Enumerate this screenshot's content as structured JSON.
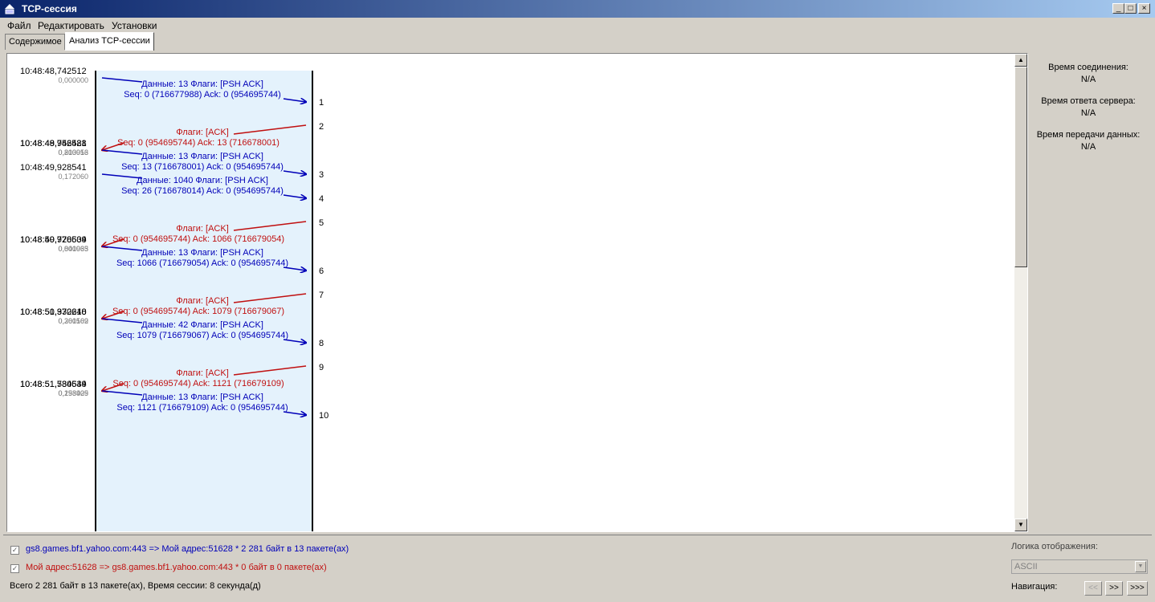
{
  "window": {
    "title": "TCP-сессия"
  },
  "menu": [
    "Файл",
    "Редактировать",
    "Установки"
  ],
  "tabs": [
    {
      "label": "Содержимое",
      "active": false
    },
    {
      "label": "Анализ TCP-сессии",
      "active": true
    }
  ],
  "colors": {
    "client": "#0000b8",
    "server": "#c01010",
    "lane_bg": "#e4f2fc"
  },
  "session": {
    "packets": [
      {
        "n": "1",
        "dir": "out",
        "time": "10:48:48,742512",
        "delta": "0,000000",
        "info": "Данные: 13 Флаги: [PSH ACK]",
        "seq": "Seq: 0 (716677988) Ack: 0 (954695744)"
      },
      {
        "n": "2",
        "dir": "in",
        "time": "10:48:48,942528",
        "delta": "0,200016",
        "info": "Флаги: [ACK]",
        "seq": "Seq: 0 (954695744) Ack: 13 (716678001)"
      },
      {
        "n": "3",
        "dir": "out",
        "time": "10:48:49,756481",
        "delta": "0,813953",
        "info": "Данные: 13 Флаги: [PSH ACK]",
        "seq": "Seq: 13 (716678001) Ack: 0 (954695744)"
      },
      {
        "n": "4",
        "dir": "out",
        "time": "10:48:49,928541",
        "delta": "0,172060",
        "info": "Данные: 1040 Флаги: [PSH ACK]",
        "seq": "Seq: 26 (716678014) Ack: 0 (954695744)"
      },
      {
        "n": "5",
        "dir": "in",
        "time": "10:48:49,928604",
        "delta": "0,000063",
        "info": "Флаги: [ACK]",
        "seq": "Seq: 0 (954695744) Ack: 1066 (716679054)"
      },
      {
        "n": "6",
        "dir": "out",
        "time": "10:48:50,770539",
        "delta": "0,841935",
        "info": "Данные: 13 Флаги: [PSH ACK]",
        "seq": "Seq: 1066 (716679054) Ack: 0 (954695744)"
      },
      {
        "n": "7",
        "dir": "in",
        "time": "10:48:50,970648",
        "delta": "0,200109",
        "info": "Флаги: [ACK]",
        "seq": "Seq: 0 (954695744) Ack: 1079 (716679067)"
      },
      {
        "n": "8",
        "dir": "out",
        "time": "10:48:51,332210",
        "delta": "0,361562",
        "info": "Данные: 42 Флаги: [PSH ACK]",
        "seq": "Seq: 1079 (716679067) Ack: 0 (954695744)"
      },
      {
        "n": "9",
        "dir": "in",
        "time": "10:48:51,530639",
        "delta": "0,198429",
        "info": "Флаги: [ACK]",
        "seq": "Seq: 0 (954695744) Ack: 1121 (716679109)"
      },
      {
        "n": "10",
        "dir": "out",
        "time": "10:48:51,784544",
        "delta": "0,253905",
        "info": "Данные: 13 Флаги: [PSH ACK]",
        "seq": "Seq: 1121 (716679109) Ack: 0 (954695744)"
      }
    ]
  },
  "side": {
    "conn_label": "Время соединения:",
    "conn_value": "N/A",
    "resp_label": "Время ответа сервера:",
    "resp_value": "N/A",
    "xfer_label": "Время передачи данных:",
    "xfer_value": "N/A"
  },
  "status": {
    "stream1": "gs8.games.bf1.yahoo.com:443 => Мой адрес:51628 * 2 281 байт в 13 пакете(ах)",
    "stream2": "Мой адрес:51628 => gs8.games.bf1.yahoo.com:443 * 0 байт в 0 пакете(ах)",
    "total": "Всего 2 281 байт в 13 пакете(ах), Время сессии: 8 секунда(д)",
    "logic_label": "Логика отображения:",
    "logic_value": "ASCII",
    "nav_label": "Навигация:",
    "nav_buttons": [
      "<<",
      ">>",
      ">>>"
    ]
  }
}
